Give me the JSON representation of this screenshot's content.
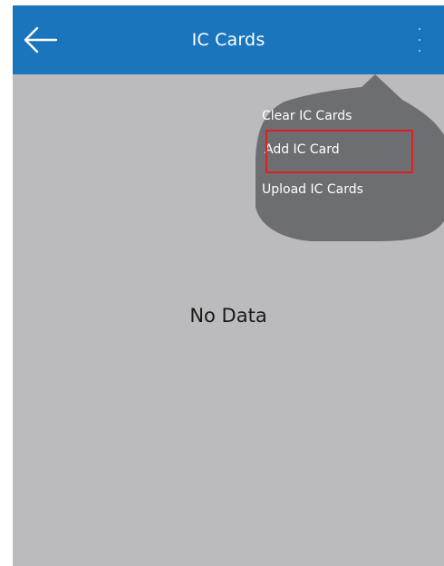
{
  "appbar": {
    "title": "IC Cards",
    "back_icon": "arrow-left-icon",
    "more_icon": "more-vertical-icon"
  },
  "menu": {
    "items": [
      {
        "label": "Clear IC Cards"
      },
      {
        "label": "Add IC Card"
      },
      {
        "label": "Upload IC Cards"
      }
    ]
  },
  "content": {
    "empty_text": "No Data"
  },
  "colors": {
    "appbar": "#1b75bc",
    "background": "#bbbbbd",
    "menu": "#6d6e71",
    "highlight": "#e02020"
  }
}
